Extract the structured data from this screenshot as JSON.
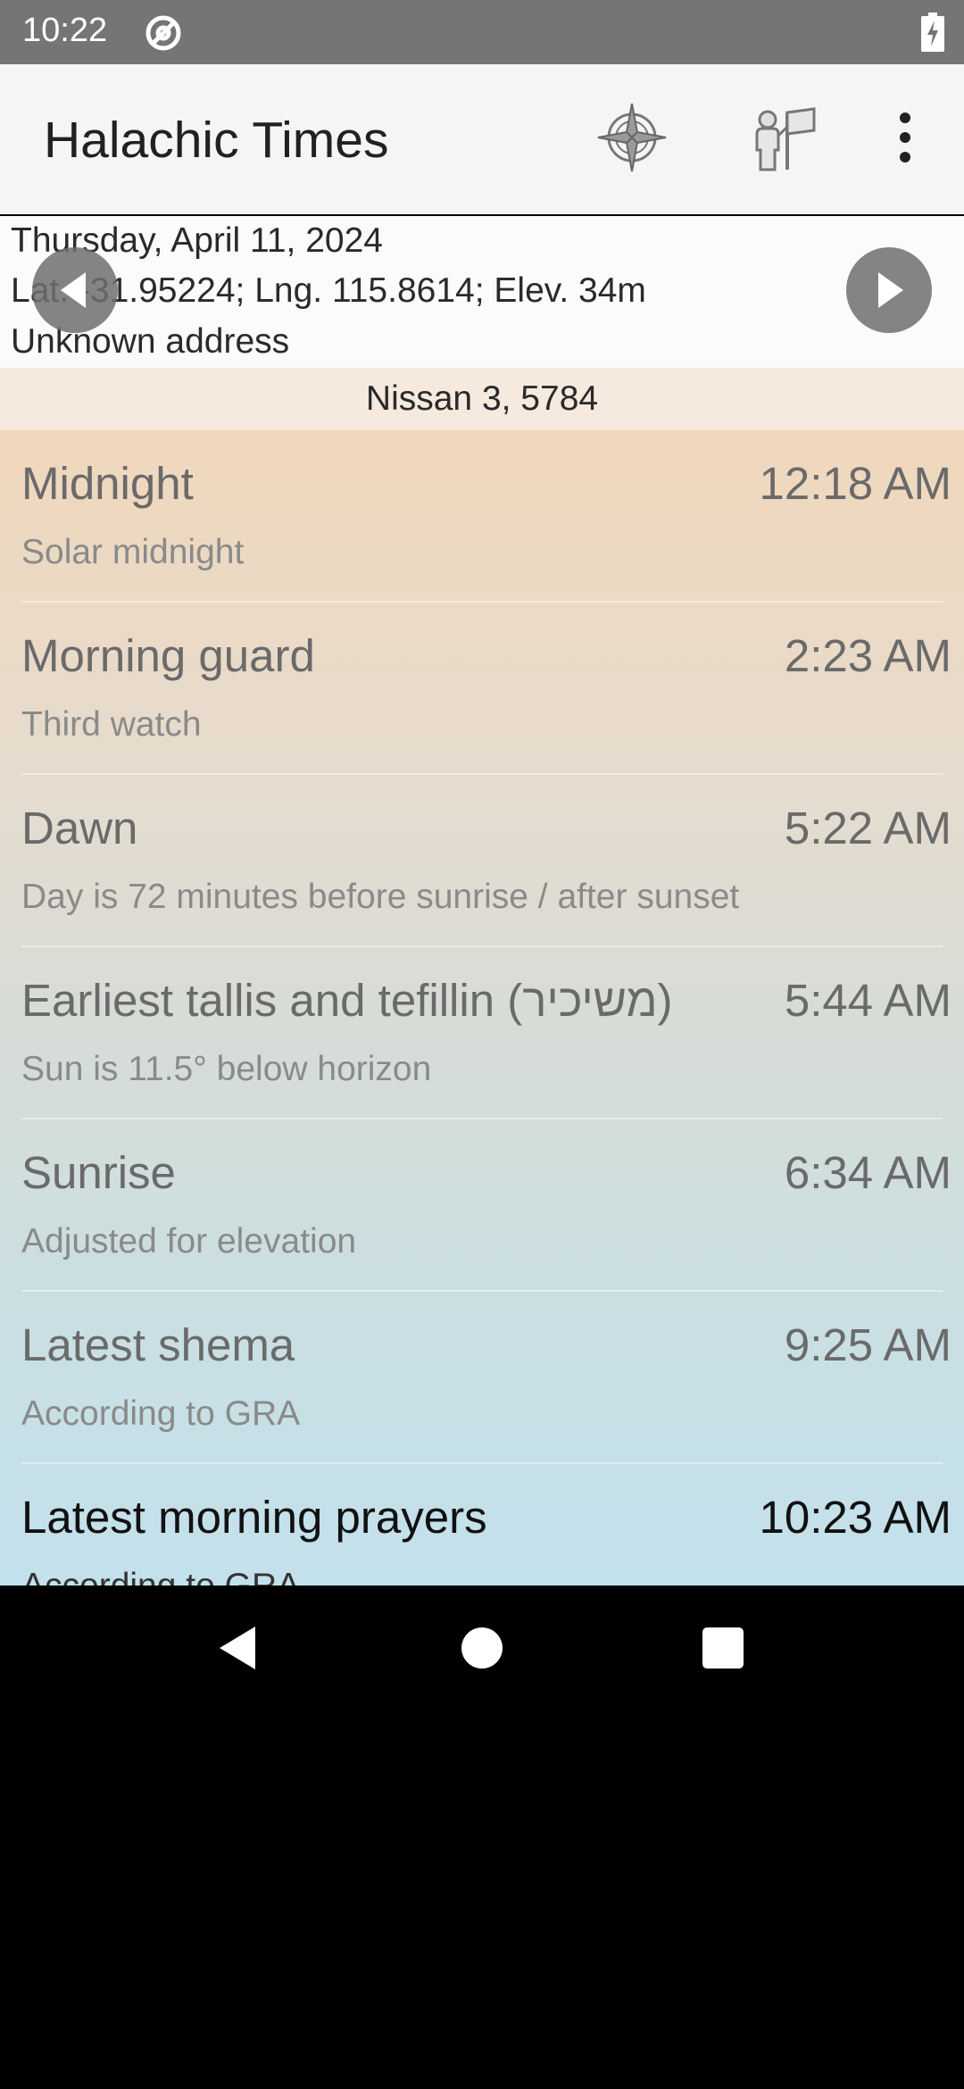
{
  "status_bar": {
    "time": "10:22",
    "icons": [
      "at-sign-icon",
      "battery-charging-icon"
    ]
  },
  "app_bar": {
    "title": "Halachic Times",
    "actions": [
      "compass-location-icon",
      "person-flag-icon",
      "more-vert-icon"
    ]
  },
  "header": {
    "date": "Thursday, April 11, 2024",
    "coordinates": "Lat. -31.95224; Lng. 115.8614; Elev. 34m",
    "address": "Unknown address"
  },
  "hebrew_date": "Nissan 3, 5784",
  "times": [
    {
      "title": "Midnight",
      "time": "12:18 AM",
      "summary": "Solar midnight",
      "current": false
    },
    {
      "title": "Morning guard",
      "time": "2:23 AM",
      "summary": "Third watch",
      "current": false
    },
    {
      "title": "Dawn",
      "time": "5:22 AM",
      "summary": "Day is 72 minutes before sunrise / after sunset",
      "current": false
    },
    {
      "title": "Earliest tallis and tefillin (משיכיר)",
      "time": "5:44 AM",
      "summary": "Sun is 11.5° below horizon",
      "current": false
    },
    {
      "title": "Sunrise",
      "time": "6:34 AM",
      "summary": "Adjusted for elevation",
      "current": false
    },
    {
      "title": "Latest shema",
      "time": "9:25 AM",
      "summary": "According to GRA",
      "current": false
    },
    {
      "title": "Latest morning prayers",
      "time": "10:23 AM",
      "summary": "According to GRA",
      "current": true
    }
  ],
  "colors": {
    "status_bar": "#757575",
    "app_bar": "#f5f5f5",
    "hebrew_date_band": "#f6e9de",
    "gradient_top": "#f0d7bc",
    "gradient_bottom": "#c3e1ec"
  }
}
